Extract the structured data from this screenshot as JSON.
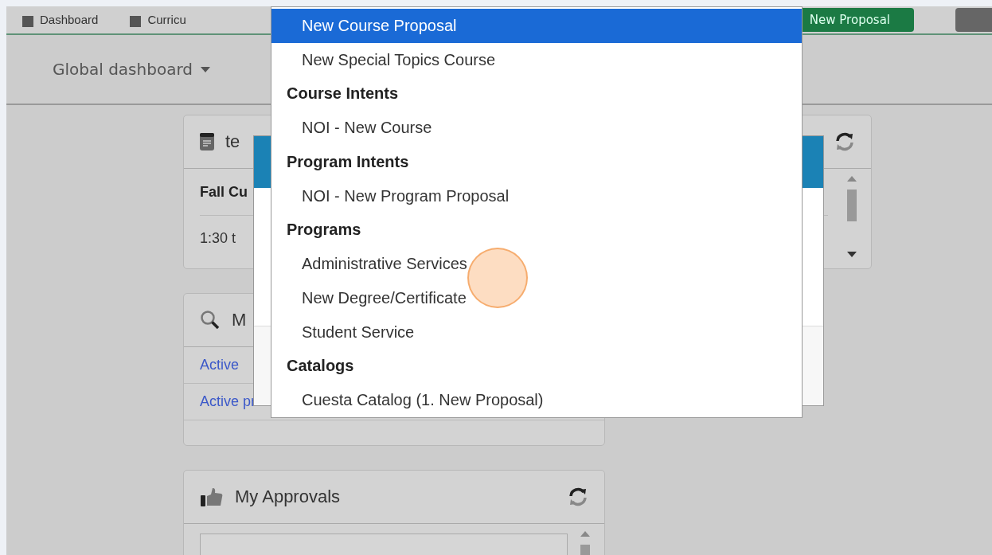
{
  "nav": {
    "items": [
      "Dashboard",
      "Curricu"
    ],
    "new_proposal_button": "New Proposal"
  },
  "dashboard_selector": {
    "label": "Global dashboard"
  },
  "event_card": {
    "title": "te",
    "event_title": "Fall Cu",
    "event_time": "1:30 t"
  },
  "search_card": {
    "title": "M",
    "links": [
      "Active",
      "Active pr"
    ]
  },
  "approvals_card": {
    "title": "My Approvals"
  },
  "menu": {
    "items": [
      {
        "kind": "item",
        "label": "New Course Proposal",
        "selected": true
      },
      {
        "kind": "item",
        "label": "New Special Topics Course",
        "selected": false
      },
      {
        "kind": "header",
        "label": "Course Intents"
      },
      {
        "kind": "item",
        "label": "NOI - New Course",
        "selected": false
      },
      {
        "kind": "header",
        "label": "Program Intents"
      },
      {
        "kind": "item",
        "label": "NOI - New Program Proposal",
        "selected": false
      },
      {
        "kind": "header",
        "label": "Programs"
      },
      {
        "kind": "item",
        "label": "Administrative Services",
        "selected": false
      },
      {
        "kind": "item",
        "label": "New Degree/Certificate",
        "selected": false
      },
      {
        "kind": "item",
        "label": "Student Service",
        "selected": false
      },
      {
        "kind": "header",
        "label": "Catalogs"
      },
      {
        "kind": "item",
        "label": "Cuesta Catalog (1. New Proposal)",
        "selected": false
      }
    ]
  }
}
